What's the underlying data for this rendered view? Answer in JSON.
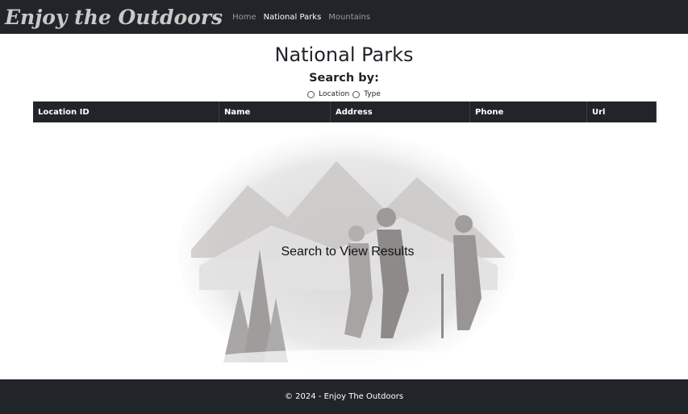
{
  "navbar": {
    "brand": "Enjoy the Outdoors",
    "links": [
      {
        "label": "Home",
        "active": false
      },
      {
        "label": "National Parks",
        "active": true
      },
      {
        "label": "Mountains",
        "active": false
      }
    ]
  },
  "main": {
    "title": "National Parks",
    "search_by": "Search by:",
    "radio_options": [
      "Location",
      "Type"
    ],
    "table": {
      "headers": [
        "Location ID",
        "Name",
        "Address",
        "Phone",
        "Url"
      ]
    },
    "hero_text": "Search to View Results"
  },
  "footer": {
    "text": "© 2024 - Enjoy The Outdoors"
  },
  "colors": {
    "navbar_bg": "#212529",
    "active_link": "#ffffff",
    "inactive_link": "#9a9a9a"
  }
}
